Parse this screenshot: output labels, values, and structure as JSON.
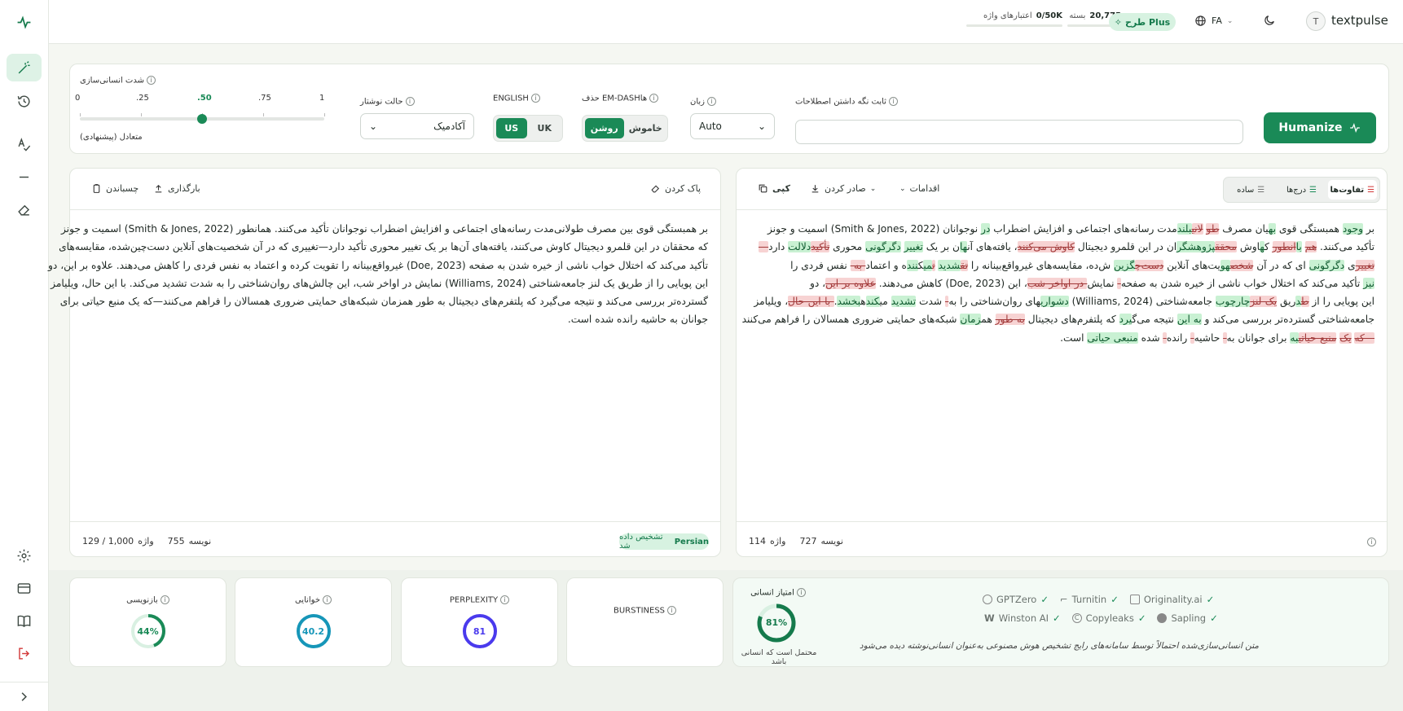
{
  "app": {
    "name": "textpulse",
    "avatar_letter": "T"
  },
  "topbar": {
    "plan_label": "طرح Plus",
    "language": "FA",
    "credits_label": "اعتبارهای واژه",
    "credits_value": "0/50K",
    "package_label": "بسته",
    "package_value": "20,775"
  },
  "settings": {
    "humanize_strength_label": "شدت انسانی‌سازی",
    "slider_ticks": [
      "0",
      ".25",
      ".50",
      ".75",
      "1"
    ],
    "slider_value": 0.5,
    "slider_caption": "متعادل (پیشنهادی)",
    "writing_mode_label": "حالت نوشتار",
    "writing_mode_value": "آکادمیک",
    "english_label": "ENGLISH",
    "english_options": [
      "US",
      "UK"
    ],
    "english_selected": "US",
    "emdash_label": "حذف EM-DASHها",
    "emdash_options": [
      "روشن",
      "خاموش"
    ],
    "emdash_selected": "روشن",
    "language_label": "زبان",
    "language_value": "Auto",
    "keep_terms_label": "ثابت نگه داشتن اصطلاحات",
    "keep_terms_placeholder": "",
    "humanize_button": "Humanize"
  },
  "input_panel": {
    "clear_label": "پاک کردن",
    "upload_label": "بارگذاری",
    "paste_label": "چسباندن",
    "text": [
      "بر همبستگی قوی بین مصرف طولانی‌مدت رسانه‌های اجتماعی و افزایش اضطراب نوجوانان تأکید می‌کنند. همانطور (Smith & Jones, 2022) اسمیت و جونز",
      "که محققان در این قلمرو دیجیتال کاوش می‌کنند، یافته‌های آن‌ها بر یک تغییر محوری تأکید دارد—تغییری که در آن شخصیت‌های آنلاین دست‌چین‌شده، مقایسه‌های",
      "تأکید می‌کند که اختلال خواب ناشی از خیره شدن به صفحه (Doe, 2023) غیرواقع‌بینانه را تقویت کرده و اعتماد به نفس فردی را کاهش می‌دهند. علاوه بر این، دو",
      "این پویایی را از طریق یک لنز جامعه‌شناختی (Williams, 2024) نمایش در اواخر شب، این چالش‌های روان‌شناختی را به شدت تشدید می‌کند. با این حال، ویلیامز",
      "گسترده‌تر بررسی می‌کند و نتیجه می‌گیرد که پلتفرم‌های دیجیتال به طور همزمان شبکه‌های حمایتی ضروری همسالان را فراهم می‌کنند—که یک منبع حیاتی برای",
      "جوانان به حاشیه رانده شده است."
    ],
    "char_count": "755",
    "char_label": "نویسه",
    "word_label": "واژه",
    "word_count": "129 / 1,000",
    "detected_lang": "Persian",
    "detected_label": "تشخیص داده شد"
  },
  "output_panel": {
    "copy_label": "کپی",
    "export_label": "صادر کردن",
    "actions_label": "اقدامات",
    "view_tabs": [
      "تفاوت‌ها",
      "درج‌ها",
      "ساده"
    ],
    "view_selected": "تفاوت‌ها",
    "char_count": "727",
    "char_label": "نویسه",
    "word_label": "واژه",
    "word_count": "114",
    "lines": [
      [
        [
          "n",
          "بر "
        ],
        [
          "i",
          "وجود"
        ],
        [
          "n",
          " همبستگی قوی "
        ],
        [
          "i",
          "به"
        ],
        [
          "n",
          "یان مصرف "
        ],
        [
          "d",
          "طو"
        ],
        [
          "n",
          " "
        ],
        [
          "d",
          "لانی"
        ],
        [
          "i",
          "بلند"
        ],
        [
          "n",
          "مدت رسانه‌های اجتماعی و افزایش اضطراب "
        ],
        [
          "i",
          "در"
        ],
        [
          "n",
          " نوجوانان (Smith & Jones, 2022) اسمیت و جونز"
        ]
      ],
      [
        [
          "n",
          "تأکید می‌کنند. "
        ],
        [
          "d",
          "هم"
        ],
        [
          "n",
          " "
        ],
        [
          "i",
          "با"
        ],
        [
          "d",
          "انطور"
        ],
        [
          "n",
          " ک"
        ],
        [
          "i",
          "ه"
        ],
        [
          "n",
          "اوش "
        ],
        [
          "d",
          "محقق"
        ],
        [
          "i",
          "پژوهشگر"
        ],
        [
          "n",
          "ان در این قلمرو دیجیتال "
        ],
        [
          "d",
          "کاوش می‌کنند"
        ],
        [
          "n",
          "، یافته‌های آن"
        ],
        [
          "i",
          "ها"
        ],
        [
          "n",
          "ن بر یک "
        ],
        [
          "i",
          "تغییر"
        ],
        [
          "n",
          " "
        ],
        [
          "i",
          "دگرگونی"
        ],
        [
          "n",
          " محوری "
        ],
        [
          "d",
          "تأکید"
        ],
        [
          "i",
          "دلالت"
        ],
        [
          "n",
          " دارد"
        ],
        [
          "d",
          "—"
        ]
      ],
      [
        [
          "d",
          "تغییر"
        ],
        [
          "n",
          "ی "
        ],
        [
          "i",
          "دگرگونی"
        ],
        [
          "n",
          " ای که در آن "
        ],
        [
          "d",
          "شخص"
        ],
        [
          "i",
          "هو"
        ],
        [
          "n",
          "یت‌های آنلاین "
        ],
        [
          "d",
          "دست‌چ"
        ],
        [
          "i",
          "گزین"
        ],
        [
          "n",
          " ش‌ده، مقایسه‌های غیرواقع‌بینانه را "
        ],
        [
          "d",
          "تق"
        ],
        [
          "i",
          "شدید"
        ],
        [
          "n",
          " "
        ],
        [
          "d",
          "ت"
        ],
        [
          "i",
          "می"
        ],
        [
          "n",
          "ک"
        ],
        [
          "i",
          "نند"
        ],
        [
          "n",
          "ه و اعتماد"
        ],
        [
          "d",
          "-به-"
        ],
        [
          "n",
          " نفس فردی را"
        ]
      ],
      [
        [
          "i",
          "نیز"
        ],
        [
          "n",
          " تأکید می‌کند که اختلال خواب ناشی از خیره شدن به صفحه"
        ],
        [
          "d",
          "-"
        ],
        [
          "n",
          " نمایش"
        ],
        [
          "d",
          "-در-اواخر-شب"
        ],
        [
          "n",
          "، این (Doe, 2023) کاهش می‌دهند. "
        ],
        [
          "d",
          "علاوه-بر-این"
        ],
        [
          "n",
          "، دو"
        ]
      ],
      [
        [
          "n",
          "این پویایی را از "
        ],
        [
          "d",
          "ط"
        ],
        [
          "i",
          "د"
        ],
        [
          "n",
          "ریق "
        ],
        [
          "d",
          "یک-لنز"
        ],
        [
          "i",
          "چارچوب"
        ],
        [
          "n",
          " جامعه‌شناختی (Williams, 2024) "
        ],
        [
          "i",
          "دشواری"
        ],
        [
          "n",
          "های روان‌شناختی را به"
        ],
        [
          "d",
          "-"
        ],
        [
          "n",
          " شدت "
        ],
        [
          "i",
          "تشدید"
        ],
        [
          "n",
          " می"
        ],
        [
          "i",
          "کند"
        ],
        [
          "n",
          "ه"
        ],
        [
          "i",
          "بخشد"
        ],
        [
          "n",
          "."
        ],
        [
          "d",
          "-با-این-حال"
        ],
        [
          "n",
          "، ویلیامز"
        ]
      ],
      [
        [
          "n",
          "جامعه‌شناختی گسترده‌تر بررسی می‌کند و "
        ],
        [
          "i",
          "به این"
        ],
        [
          "n",
          " نتیجه می‌گ"
        ],
        [
          "i",
          "یرد"
        ],
        [
          "n",
          " که پلتفرم‌های دیجیتال "
        ],
        [
          "d",
          "به-طور"
        ],
        [
          "n",
          " هم"
        ],
        [
          "i",
          "زمان"
        ],
        [
          "n",
          " شبکه‌های حمایتی ضروری همسالان را فراهم می‌کنند"
        ]
      ],
      [
        [
          "d",
          "—که"
        ],
        [
          "n",
          " "
        ],
        [
          "d",
          "یک"
        ],
        [
          "n",
          " "
        ],
        [
          "d",
          "منبع-حیاتی"
        ],
        [
          "i",
          "به"
        ],
        [
          "n",
          " برای جوانان به"
        ],
        [
          "d",
          "-"
        ],
        [
          "n",
          " حاشیه"
        ],
        [
          "d",
          "-"
        ],
        [
          "n",
          " رانده"
        ],
        [
          "d",
          "-"
        ],
        [
          "n",
          " شده "
        ],
        [
          "i",
          "منبعی حیاتی"
        ],
        [
          "n",
          " است."
        ]
      ]
    ]
  },
  "metrics": {
    "readability_label": "خوانایی",
    "readability_value": "40.2",
    "rewrite_label": "بازنویسی",
    "rewrite_value": "44%",
    "rewrite_fraction": 0.44,
    "perplexity_label": "PERPLEXITY",
    "perplexity_value": "81",
    "burstiness_label": "BURSTINESS",
    "human_label": "امتیاز انسانی",
    "human_value": "81%",
    "human_fraction": 0.81,
    "human_caption": "محتمل است که انسانی باشد",
    "detectors": [
      "GPTZero",
      "Turnitin",
      "Originality.ai",
      "Winston AI",
      "Copyleaks",
      "Sapling"
    ],
    "detectors_caption": "متن انسانی‌سازی‌شده احتمالاً توسط سامانه‌های رایج تشخیص هوش مصنوعی به‌عنوان انسانی‌نوشته دیده می‌شود"
  },
  "colors": {
    "accent": "#1a8a57",
    "ins_bg": "#c9f1d3",
    "del_bg": "#f7d3d3",
    "perplexity": "#4a3aed",
    "readability": "#1696b8"
  }
}
